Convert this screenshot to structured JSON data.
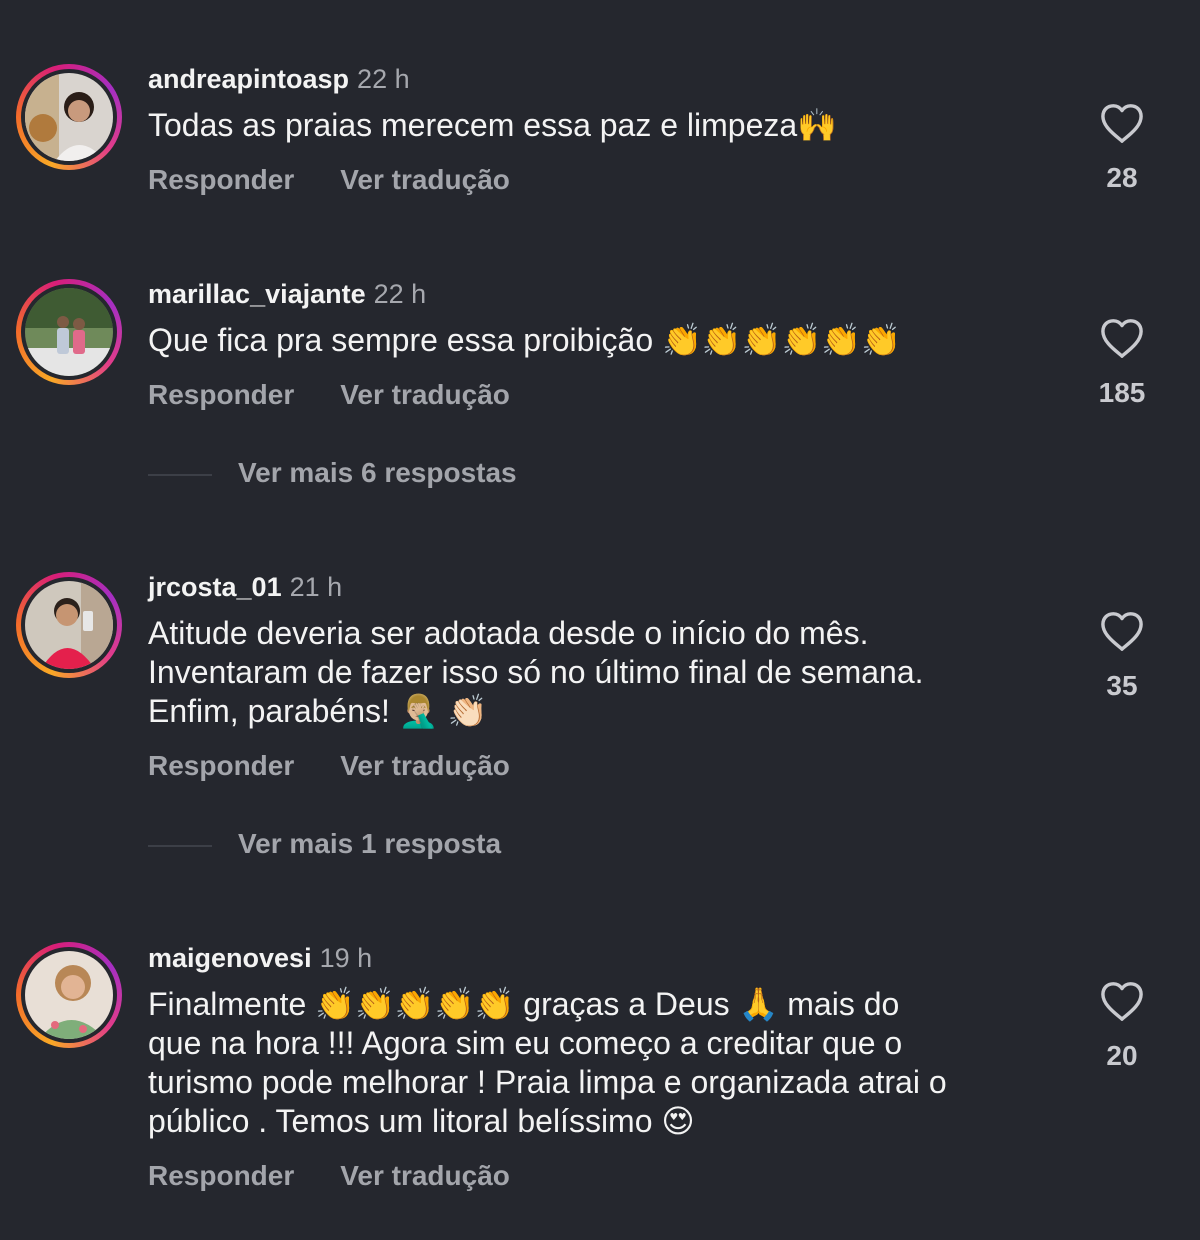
{
  "comments": [
    {
      "username": "andreapintoasp",
      "time": "22 h",
      "text": "Todas as praias merecem essa paz e limpeza🙌",
      "reply_label": "Responder",
      "translate_label": "Ver tradução",
      "likes": "28"
    },
    {
      "username": "marillac_viajante",
      "time": "22 h",
      "text": "Que fica pra sempre essa proibição 👏👏👏👏👏👏",
      "reply_label": "Responder",
      "translate_label": "Ver tradução",
      "likes": "185",
      "more_replies": "Ver mais 6 respostas"
    },
    {
      "username": "jrcosta_01",
      "time": "21 h",
      "text_lines": [
        "Atitude deveria ser adotada desde o início do mês.",
        "Inventaram de fazer isso só no último final de semana.",
        "Enfim, parabéns! 🤦🏼‍♂️ 👏🏻"
      ],
      "reply_label": "Responder",
      "translate_label": "Ver tradução",
      "likes": "35",
      "more_replies": "Ver mais 1 resposta"
    },
    {
      "username": "maigenovesi",
      "time": "19 h",
      "text_lines": [
        "Finalmente 👏👏👏👏👏 graças a Deus 🙏 mais do",
        "que na hora !!! Agora sim eu começo a creditar que o",
        "turismo pode melhorar ! Praia limpa e organizada atrai o",
        "público . Temos um litoral belíssimo 😍"
      ],
      "reply_label": "Responder",
      "translate_label": "Ver tradução",
      "likes": "20"
    }
  ],
  "icons": {
    "like": "heart-outline-icon",
    "avatar_ring": "story-ring"
  },
  "colors": {
    "background": "#25272e",
    "secondary_text": "#a3a5ab"
  }
}
